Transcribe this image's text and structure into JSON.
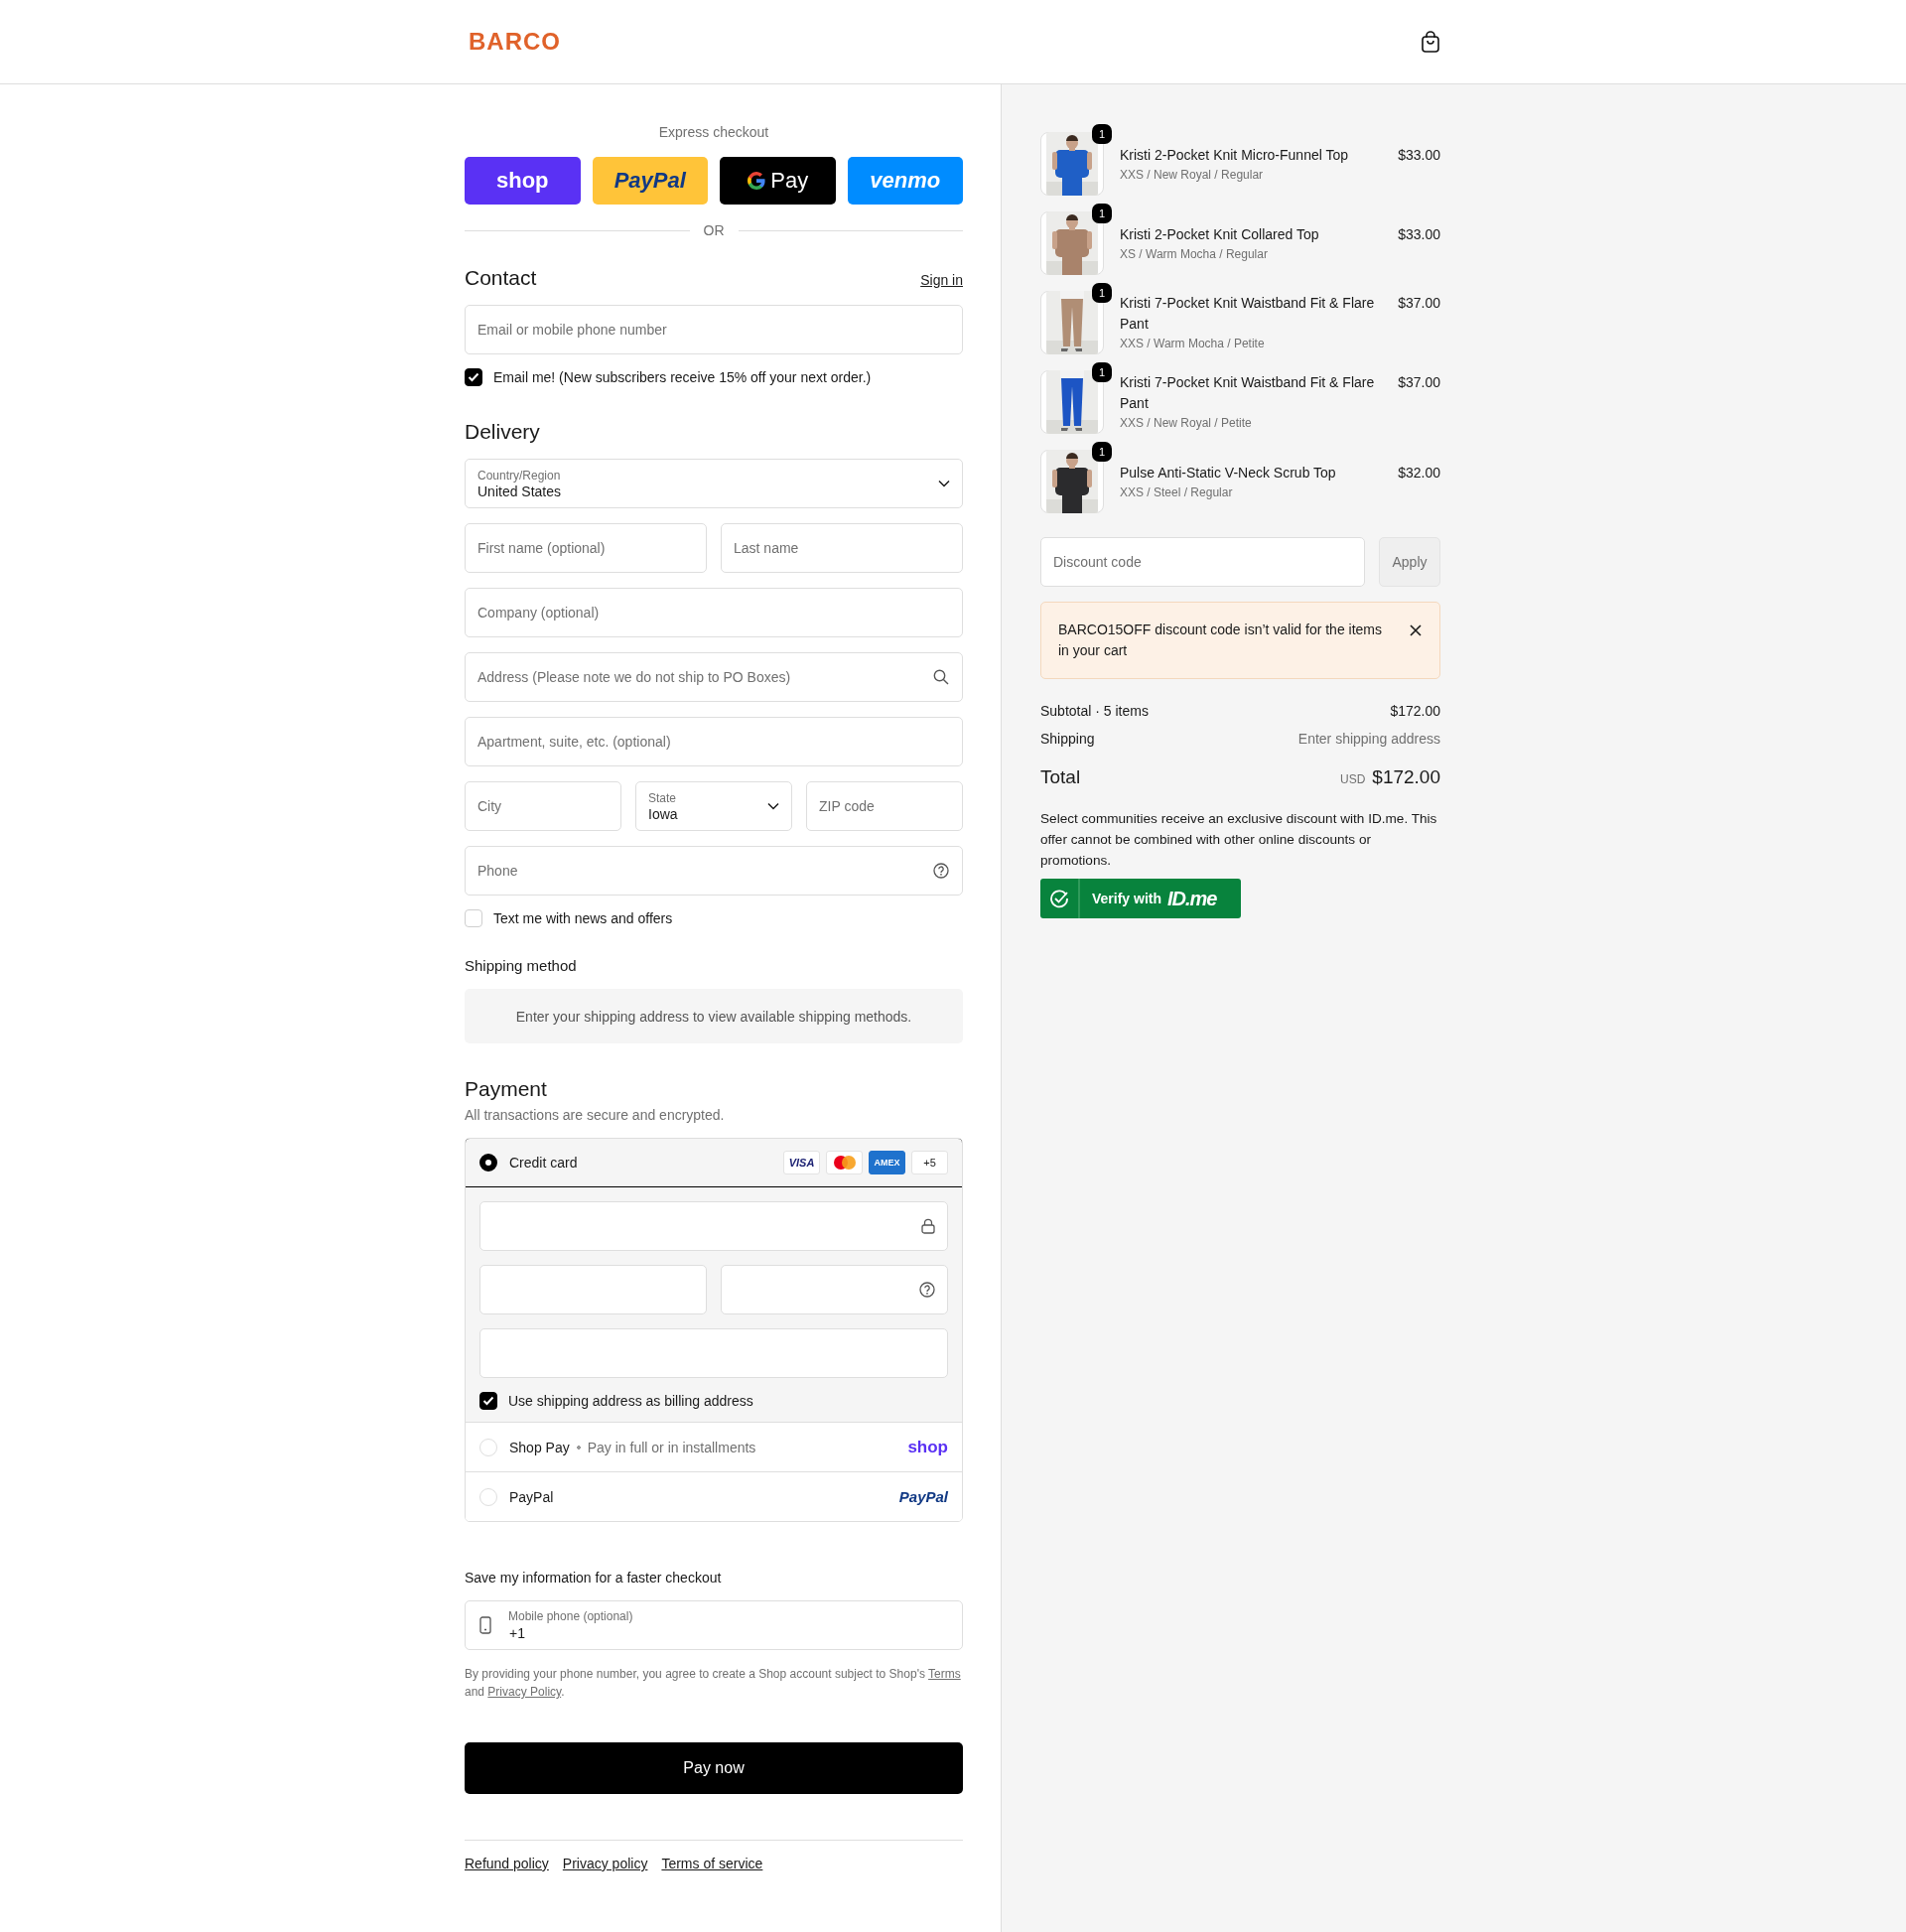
{
  "header": {
    "logo": "BARCO"
  },
  "express": {
    "label": "Express checkout",
    "divider": "OR",
    "buttons": [
      {
        "kind": "shop",
        "label": "shop"
      },
      {
        "kind": "paypal",
        "label": "PayPal"
      },
      {
        "kind": "gpay",
        "label": "Pay"
      },
      {
        "kind": "venmo",
        "label": "venmo"
      }
    ]
  },
  "contact": {
    "title": "Contact",
    "sign_in": "Sign in",
    "email": {
      "placeholder": "Email or mobile phone number"
    },
    "newsletter": {
      "label": "Email me! (New subscribers receive 15% off your next order.)",
      "checked": true
    }
  },
  "delivery": {
    "title": "Delivery",
    "rows": [
      [
        {
          "kind": "select",
          "label": "Country/Region",
          "value": "United States"
        }
      ],
      [
        {
          "kind": "text",
          "placeholder": "First name (optional)"
        },
        {
          "kind": "text",
          "placeholder": "Last name"
        }
      ],
      [
        {
          "kind": "text",
          "placeholder": "Company (optional)"
        }
      ],
      [
        {
          "kind": "search",
          "placeholder": "Address (Please note we do not ship to PO Boxes)"
        }
      ],
      [
        {
          "kind": "text",
          "placeholder": "Apartment, suite, etc. (optional)"
        }
      ],
      [
        {
          "kind": "text",
          "placeholder": "City"
        },
        {
          "kind": "select",
          "label": "State",
          "value": "Iowa"
        },
        {
          "kind": "text",
          "placeholder": "ZIP code"
        }
      ],
      [
        {
          "kind": "help",
          "placeholder": "Phone"
        }
      ]
    ],
    "sms": {
      "label": "Text me with news and offers",
      "checked": false
    }
  },
  "shipping_method": {
    "title": "Shipping method",
    "notice": "Enter your shipping address to view available shipping methods."
  },
  "payment": {
    "title": "Payment",
    "subtitle": "All transactions are secure and encrypted.",
    "methods": [
      {
        "kind": "card",
        "label": "Credit card",
        "selected": true,
        "brands": [
          {
            "kind": "visa",
            "label": "VISA"
          },
          {
            "kind": "mastercard"
          },
          {
            "kind": "amex",
            "label": "AMEX"
          },
          {
            "kind": "more",
            "label": "+5"
          }
        ],
        "billing_same": {
          "label": "Use shipping address as billing address",
          "checked": true
        }
      },
      {
        "kind": "shop_pay",
        "label": "Shop Pay",
        "detail": "Pay in full or in installments",
        "logo": "shop",
        "selected": false
      },
      {
        "kind": "paypal",
        "label": "PayPal",
        "logo": "PayPal",
        "selected": false
      }
    ]
  },
  "save_info": {
    "title": "Save my information for a faster checkout",
    "phone": {
      "label": "Mobile phone (optional)",
      "value": "+1"
    },
    "legal": [
      {
        "kind": "text",
        "text": "By providing your phone number, you agree to create a Shop account subject to Shop's "
      },
      {
        "kind": "link",
        "text": "Terms"
      },
      {
        "kind": "text",
        "text": " and "
      },
      {
        "kind": "link",
        "text": "Privacy Policy"
      },
      {
        "kind": "text",
        "text": "."
      }
    ]
  },
  "pay_button": "Pay now",
  "footer_links": [
    "Refund policy",
    "Privacy policy",
    "Terms of service"
  ],
  "summary": {
    "items": [
      {
        "name": "Kristi 2-Pocket Knit Micro-Funnel Top",
        "variant": "XXS / New Royal / Regular",
        "price": "$33.00",
        "quantity": "1"
      },
      {
        "name": "Kristi 2-Pocket Knit Collared Top",
        "variant": "XS / Warm Mocha / Regular",
        "price": "$33.00",
        "quantity": "1"
      },
      {
        "name": "Kristi 7-Pocket Knit Waistband Fit & Flare Pant",
        "variant": "XXS / Warm Mocha / Petite",
        "price": "$37.00",
        "quantity": "1"
      },
      {
        "name": "Kristi 7-Pocket Knit Waistband Fit & Flare Pant",
        "variant": "XXS / New Royal / Petite",
        "price": "$37.00",
        "quantity": "1"
      },
      {
        "name": "Pulse Anti-Static V-Neck Scrub Top",
        "variant": "XXS / Steel / Regular",
        "price": "$32.00",
        "quantity": "1"
      }
    ],
    "discount": {
      "placeholder": "Discount code",
      "button": "Apply"
    },
    "alert": "BARCO15OFF discount code isn’t valid for the items in your cart",
    "subtotal_label": "Subtotal · 5 items",
    "subtotal": "$172.00",
    "shipping_label": "Shipping",
    "shipping_value": "Enter shipping address",
    "total_label": "Total",
    "currency": "USD",
    "total": "$172.00",
    "idme": {
      "text": "Select communities receive an exclusive discount with ID.me. This offer cannot be combined with other online discounts or promotions.",
      "button_label": "Verify with",
      "brand": "ID.me"
    }
  }
}
